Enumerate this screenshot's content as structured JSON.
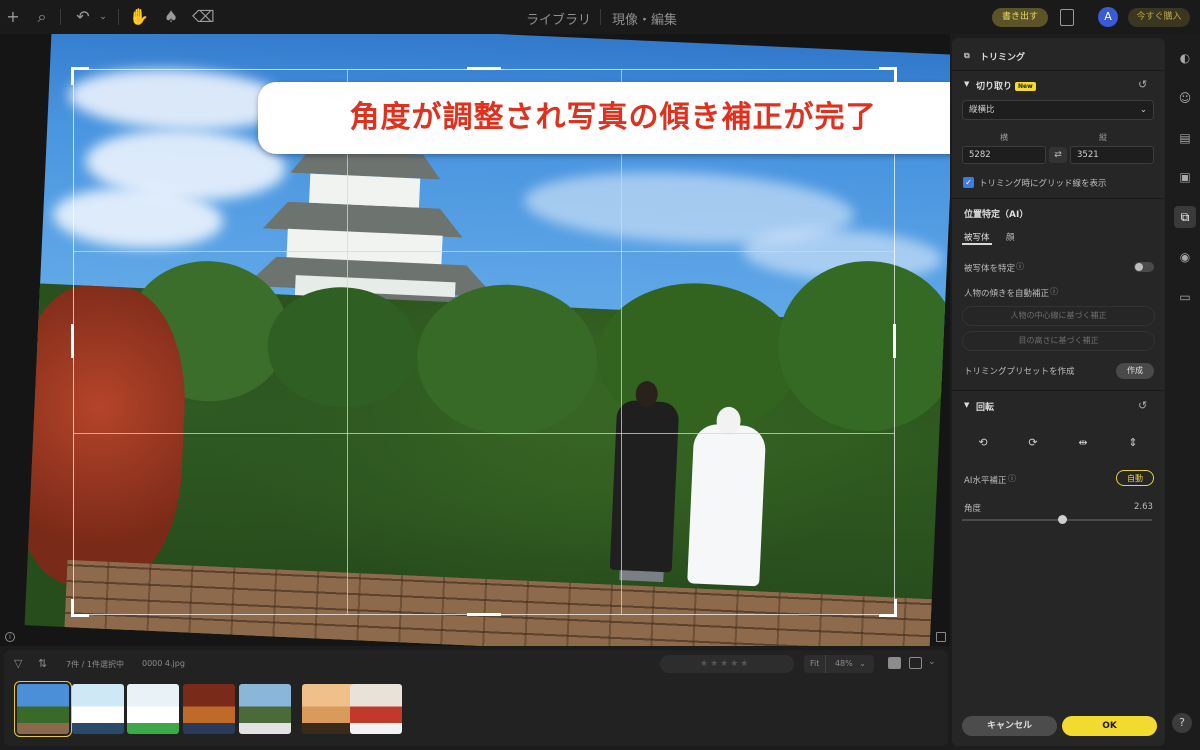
{
  "topbar": {
    "title_library": "ライブラリ",
    "title_develop": "現像・編集",
    "export_label": "書き出す",
    "avatar_letter": "A",
    "buy_label": "今すぐ購入"
  },
  "canvas": {
    "banner": "角度が調整され写真の傾き補正が完了"
  },
  "filmstrip": {
    "count_label": "7件 / 1件選択中",
    "file_name": "0000 4.jpg",
    "fit_label": "Fit",
    "zoom_label": "48%",
    "thumbnails": [
      {
        "name": "castle",
        "selected": true,
        "colors": [
          "#4a8fd8",
          "#3a6a2a",
          "#8b6a4c"
        ]
      },
      {
        "name": "portrait-1",
        "selected": false,
        "colors": [
          "#cfe8f5",
          "#ffffff",
          "#2a4a6a"
        ]
      },
      {
        "name": "portrait-2",
        "selected": false,
        "colors": [
          "#e9f2f7",
          "#ffffff",
          "#3ca84a"
        ]
      },
      {
        "name": "autumn-walk",
        "selected": false,
        "colors": [
          "#7a2a18",
          "#c06a2a",
          "#2a3a5a"
        ]
      },
      {
        "name": "bridge",
        "selected": false,
        "colors": [
          "#8ab6d8",
          "#4a6a3a",
          "#e2e2e2"
        ]
      },
      {
        "name": "beach",
        "selected": false,
        "colors": [
          "#f0c08a",
          "#d99a5a",
          "#3a2a1a"
        ]
      },
      {
        "name": "kimono",
        "selected": false,
        "colors": [
          "#e8e2d8",
          "#c0392b",
          "#f2f2f2"
        ]
      }
    ]
  },
  "panel": {
    "header": "トリミング",
    "crop_section": "切り取り",
    "new_badge": "New",
    "aspect_select": "縦横比",
    "width_label": "横",
    "height_label": "縦",
    "width_value": "5282",
    "height_value": "3521",
    "grid_checkbox": "トリミング時にグリッド線を表示",
    "position_section": "位置特定（AI）",
    "tab_subject": "被写体",
    "tab_face": "顔",
    "detect_subject": "被写体を特定",
    "auto_tilt": "人物の傾きを自動補正",
    "center_correct": "人物の中心線に基づく補正",
    "eye_correct": "目の高さに基づく補正",
    "preset_label": "トリミングプリセットを作成",
    "preset_button": "作成",
    "rotate_section": "回転",
    "ai_level": "AI水平補正",
    "auto_button": "自動",
    "angle_label": "角度",
    "angle_value": "2.63",
    "cancel": "キャンセル",
    "ok": "OK"
  },
  "rail": {
    "icons": [
      "palette-icon",
      "face-icon",
      "layers-icon",
      "clothes-icon",
      "crop-icon",
      "camera-icon",
      "folder-icon"
    ]
  }
}
